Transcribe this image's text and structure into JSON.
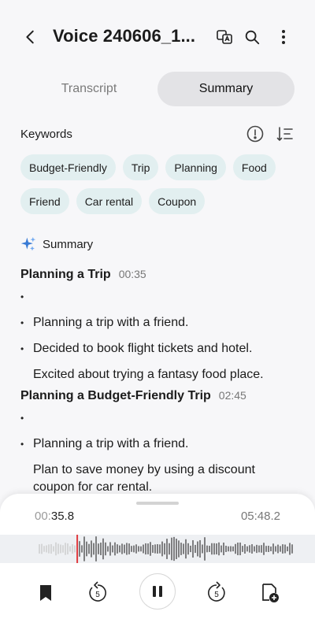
{
  "header": {
    "title": "Voice 240606_1...",
    "icons": [
      "back-arrow-icon",
      "translate-icon",
      "search-icon",
      "more-vertical-icon"
    ]
  },
  "tabs": [
    {
      "label": "Transcript",
      "active": false
    },
    {
      "label": "Summary",
      "active": true
    }
  ],
  "keywords": {
    "title": "Keywords",
    "chips": [
      "Budget-Friendly",
      "Trip",
      "Planning",
      "Food",
      "Friend",
      "Car rental",
      "Coupon"
    ]
  },
  "summary": {
    "title": "Summary",
    "sections": [
      {
        "title": "Planning a Trip",
        "time": "00:35",
        "bullets": [
          "",
          "Planning a trip with a friend.",
          "Decided to book flight tickets and hotel.",
          "Excited about trying a fantasy food place."
        ]
      },
      {
        "title": "Planning a Budget-Friendly Trip",
        "time": "02:45",
        "bullets": [
          "",
          "Planning a trip with a friend.",
          "Plan to save money by using a discount coupon for car rental."
        ]
      }
    ]
  },
  "player": {
    "current_prefix": "00:",
    "current_main": "35.8",
    "total": "05:48.2",
    "progress": 0.103,
    "rewind_seconds": "5",
    "forward_seconds": "5",
    "accent": "#e0393e",
    "controls": [
      "bookmark-icon",
      "rewind-5-icon",
      "pause-icon",
      "forward-5-icon",
      "add-note-icon"
    ]
  }
}
